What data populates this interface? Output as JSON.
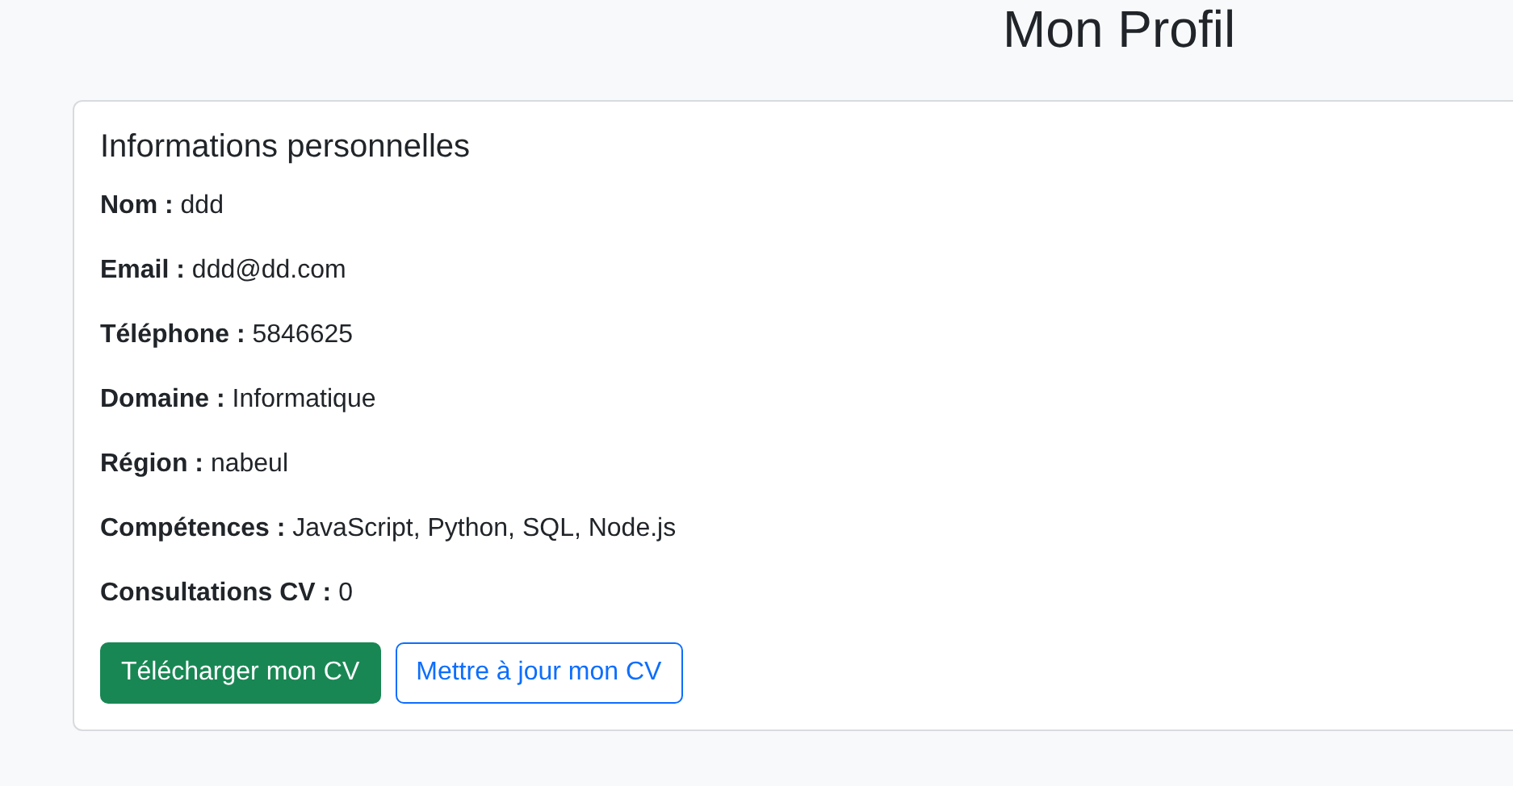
{
  "page": {
    "title": "Mon Profil"
  },
  "card": {
    "title": "Informations personnelles",
    "fields": [
      {
        "label": "Nom :",
        "value": "ddd"
      },
      {
        "label": "Email :",
        "value": "ddd@dd.com"
      },
      {
        "label": "Téléphone :",
        "value": "5846625"
      },
      {
        "label": "Domaine :",
        "value": "Informatique"
      },
      {
        "label": "Région :",
        "value": "nabeul"
      },
      {
        "label": "Compétences :",
        "value": "JavaScript, Python, SQL, Node.js"
      },
      {
        "label": "Consultations CV :",
        "value": "0"
      }
    ],
    "buttons": [
      {
        "label": "Télécharger mon CV",
        "kind": "solid"
      },
      {
        "label": "Mettre à jour mon CV",
        "kind": "outline"
      }
    ]
  }
}
